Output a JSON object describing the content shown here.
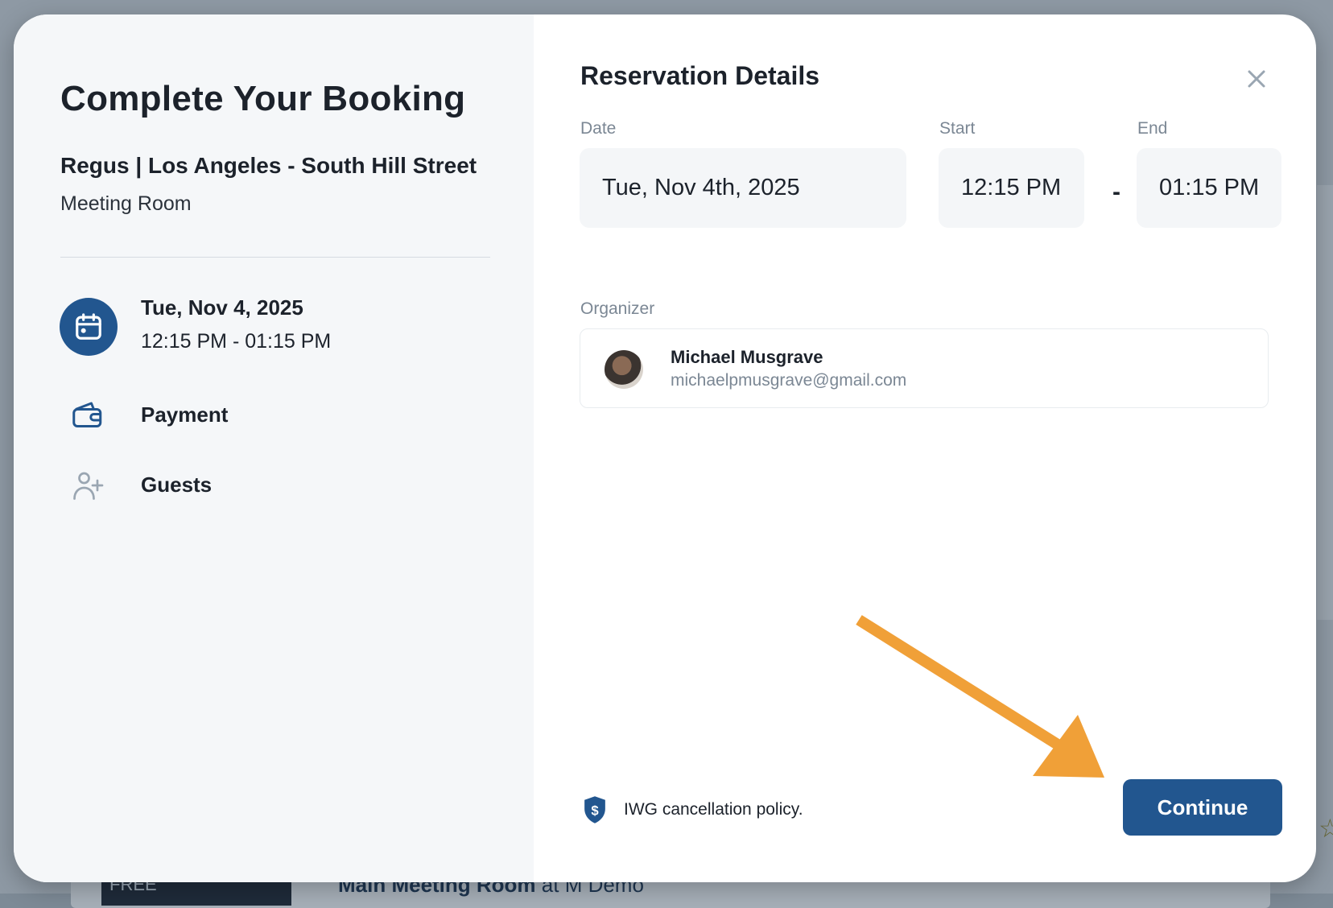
{
  "background": {
    "thumb_text": "FREE",
    "listing_title_bold": "Main Meeting Room",
    "listing_title_rest": " at M Demo"
  },
  "booking": {
    "title": "Complete Your Booking",
    "location_name": "Regus | Los Angeles - South Hill Street",
    "room_type": "Meeting Room",
    "summary_date": "Tue, Nov 4, 2025",
    "summary_time": "12:15 PM - 01:15 PM",
    "steps": [
      {
        "label": "Payment",
        "icon": "wallet-icon"
      },
      {
        "label": "Guests",
        "icon": "add-user-icon"
      }
    ]
  },
  "reservation": {
    "heading": "Reservation Details",
    "date_label": "Date",
    "date_value": "Tue, Nov 4th, 2025",
    "start_label": "Start",
    "start_value": "12:15 PM",
    "end_label": "End",
    "end_value": "01:15 PM",
    "separator": "-",
    "organizer_label": "Organizer",
    "organizer_name": "Michael Musgrave",
    "organizer_email": "michaelpmusgrave@gmail.com",
    "policy_text": "IWG cancellation policy.",
    "continue_label": "Continue"
  },
  "colors": {
    "primary": "#22568f",
    "annotation_arrow": "#f0a038",
    "left_panel_bg": "#f5f7f9",
    "field_bg": "#f4f6f8"
  }
}
